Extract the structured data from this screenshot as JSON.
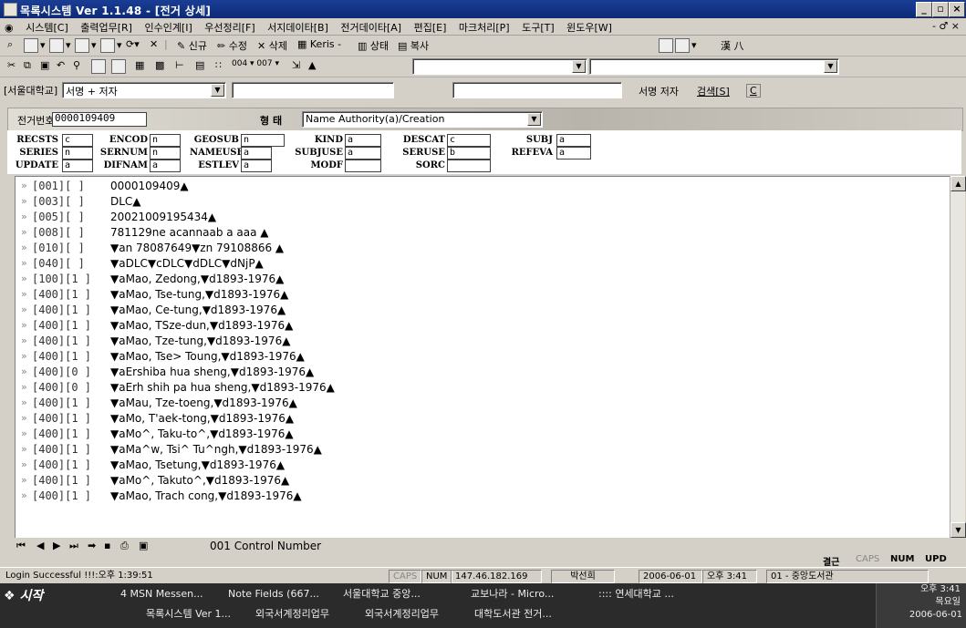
{
  "window": {
    "title": "목록시스템 Ver 1.1.48 - [전거 상세]",
    "minimize": "_",
    "restore": "▫",
    "close": "×"
  },
  "menu": [
    "시스템[C]",
    "출력업무[R]",
    "인수인계[I]",
    "우선정리[F]",
    "서지데이타[B]",
    "전거데이타[A]",
    "편집[E]",
    "마크처리[P]",
    "도구[T]",
    "윈도우[W]"
  ],
  "menu_right": "- ♂ ×",
  "toolbar1": {
    "new_label": "신규",
    "modify_label": "수정",
    "delete_label": "삭제",
    "keris_label": "Keris -",
    "status_label": "상태",
    "copy_label": "복사",
    "hanja_label": "漢 ⼋"
  },
  "toolbar2": {
    "codes": "004 ▾  007 ▾"
  },
  "search": {
    "library": "[서울대학교]",
    "field": "서명 + 저자",
    "title_author_label": "서명 저자",
    "search_button": "검색[S]",
    "clear_button": "C"
  },
  "record": {
    "authority_no_label": "전거번호",
    "authority_no": "0000109409",
    "form_label": "형 태",
    "form_value": "Name Authority(a)/Creation"
  },
  "fixed_fields": [
    {
      "label": "RECSTS",
      "value": "c"
    },
    {
      "label": "ENCOD",
      "value": "n"
    },
    {
      "label": "GEOSUB",
      "value": "n"
    },
    {
      "label": "KIND",
      "value": "a"
    },
    {
      "label": "DESCAT",
      "value": "c"
    },
    {
      "label": "SUBJ",
      "value": "a"
    },
    {
      "label": "SERIES",
      "value": "n"
    },
    {
      "label": "SERNUM",
      "value": "n"
    },
    {
      "label": "NAMEUSE",
      "value": "a"
    },
    {
      "label": "SUBJUSE",
      "value": "a"
    },
    {
      "label": "SERUSE",
      "value": "b"
    },
    {
      "label": "REFEVA",
      "value": "a"
    },
    {
      "label": "UPDATE",
      "value": "a"
    },
    {
      "label": "DIFNAM",
      "value": "a"
    },
    {
      "label": "ESTLEV",
      "value": "a"
    },
    {
      "label": "MODF",
      "value": ""
    },
    {
      "label": "SORC",
      "value": ""
    }
  ],
  "marc_rows": [
    {
      "tag": "[001][  ]",
      "text": "0000109409▲"
    },
    {
      "tag": "[003][  ]",
      "text": "DLC▲"
    },
    {
      "tag": "[005][  ]",
      "text": "20021009195434▲"
    },
    {
      "tag": "[008][  ]",
      "text": "781129ne acannaab          a aaa         ▲"
    },
    {
      "tag": "[010][  ]",
      "text": "▼an  78087649▼zn  79108866 ▲"
    },
    {
      "tag": "[040][  ]",
      "text": "▼aDLC▼cDLC▼dDLC▼dNjP▲"
    },
    {
      "tag": "[100][1 ]",
      "text": "▼aMao, Zedong,▼d1893-1976▲"
    },
    {
      "tag": "[400][1 ]",
      "text": "▼aMao, Tse-tung,▼d1893-1976▲"
    },
    {
      "tag": "[400][1 ]",
      "text": "▼aMao, Ce-tung,▼d1893-1976▲"
    },
    {
      "tag": "[400][1 ]",
      "text": "▼aMao, TSze-dun,▼d1893-1976▲"
    },
    {
      "tag": "[400][1 ]",
      "text": "▼aMao, Tze-tung,▼d1893-1976▲"
    },
    {
      "tag": "[400][1 ]",
      "text": "▼aMao, Tse> Toung,▼d1893-1976▲"
    },
    {
      "tag": "[400][0 ]",
      "text": "▼aErshiba hua sheng,▼d1893-1976▲"
    },
    {
      "tag": "[400][0 ]",
      "text": "▼aErh shih pa hua sheng,▼d1893-1976▲"
    },
    {
      "tag": "[400][1 ]",
      "text": "▼aMau, Tze-toeng,▼d1893-1976▲"
    },
    {
      "tag": "[400][1 ]",
      "text": "▼aMo, T'aek-tong,▼d1893-1976▲"
    },
    {
      "tag": "[400][1 ]",
      "text": "▼aMo^, Taku-to^,▼d1893-1976▲"
    },
    {
      "tag": "[400][1 ]",
      "text": "▼aMa^w, Tsi^ Tu^ngh,▼d1893-1976▲"
    },
    {
      "tag": "[400][1 ]",
      "text": "▼aMao, Tsetung,▼d1893-1976▲"
    },
    {
      "tag": "[400][1 ]",
      "text": "▼aMo^, Takuto^,▼d1893-1976▲"
    },
    {
      "tag": "[400][1 ]",
      "text": "▼aMao, Trach cong,▼d1893-1976▲"
    }
  ],
  "nav": {
    "field_name": "001  Control Number",
    "mode": "결근",
    "caps": "CAPS",
    "num": "NUM",
    "upd": "UPD"
  },
  "status": {
    "message": "Login Successful !!!:오후 1:39:51",
    "caps": "CAPS",
    "num": "NUM",
    "ip": "147.46.182.169",
    "user": "박선희",
    "date": "2006-06-01",
    "time": "오후 3:41",
    "library": "01 - 중앙도서관"
  },
  "taskbar": {
    "start": "시작",
    "items_top": [
      "4 MSN Messen...",
      "Note Fields (667...",
      "서울대학교 중앙...",
      "교보나라 - Micro...",
      ":::: 연세대학교 ..."
    ],
    "items_bottom": [
      "목록시스템 Ver 1...",
      "외국서계정리업무",
      "외국서계정리업무",
      "대학도서관 전거..."
    ],
    "clock_time": "오후 3:41",
    "clock_day": "목요일",
    "clock_date": "2006-06-01"
  }
}
